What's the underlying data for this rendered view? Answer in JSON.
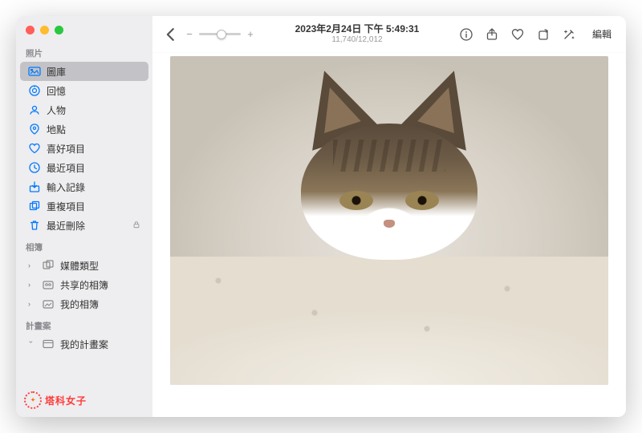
{
  "window": {
    "title": "2023年2月24日 下午 5:49:31",
    "subtitle": "11,740/12,012"
  },
  "toolbar": {
    "zoom_minus": "−",
    "zoom_plus": "+",
    "edit_label": "編輯"
  },
  "sidebar": {
    "sections": {
      "library_header": "照片",
      "albums_header": "相簿",
      "projects_header": "計畫案"
    },
    "library": [
      {
        "icon": "photo-library-icon",
        "label": "圖庫",
        "selected": true
      },
      {
        "icon": "memories-icon",
        "label": "回憶"
      },
      {
        "icon": "people-icon",
        "label": "人物"
      },
      {
        "icon": "places-icon",
        "label": "地點"
      },
      {
        "icon": "heart-icon",
        "label": "喜好項目"
      },
      {
        "icon": "clock-icon",
        "label": "最近項目"
      },
      {
        "icon": "import-icon",
        "label": "輸入記錄"
      },
      {
        "icon": "duplicate-icon",
        "label": "重複項目"
      },
      {
        "icon": "trash-icon",
        "label": "最近刪除",
        "locked": true
      }
    ],
    "albums": [
      {
        "icon": "media-types-icon",
        "label": "媒體類型",
        "expandable": true
      },
      {
        "icon": "shared-albums-icon",
        "label": "共享的相簿",
        "expandable": true
      },
      {
        "icon": "my-albums-icon",
        "label": "我的相簿",
        "expandable": true
      }
    ],
    "projects": [
      {
        "icon": "my-projects-icon",
        "label": "我的計畫案",
        "expandable": true,
        "expanded": true
      }
    ]
  },
  "watermark": {
    "text": "塔科女子"
  },
  "photo": {
    "description": "一隻虎斑貓趴在淺色毯子上，臉部特寫，耳朵豎立，黃綠色眼睛注視前方"
  },
  "colors": {
    "accent": "#007aff",
    "sidebar_bg": "#eeedef",
    "selected_bg": "#c3c3c7"
  }
}
